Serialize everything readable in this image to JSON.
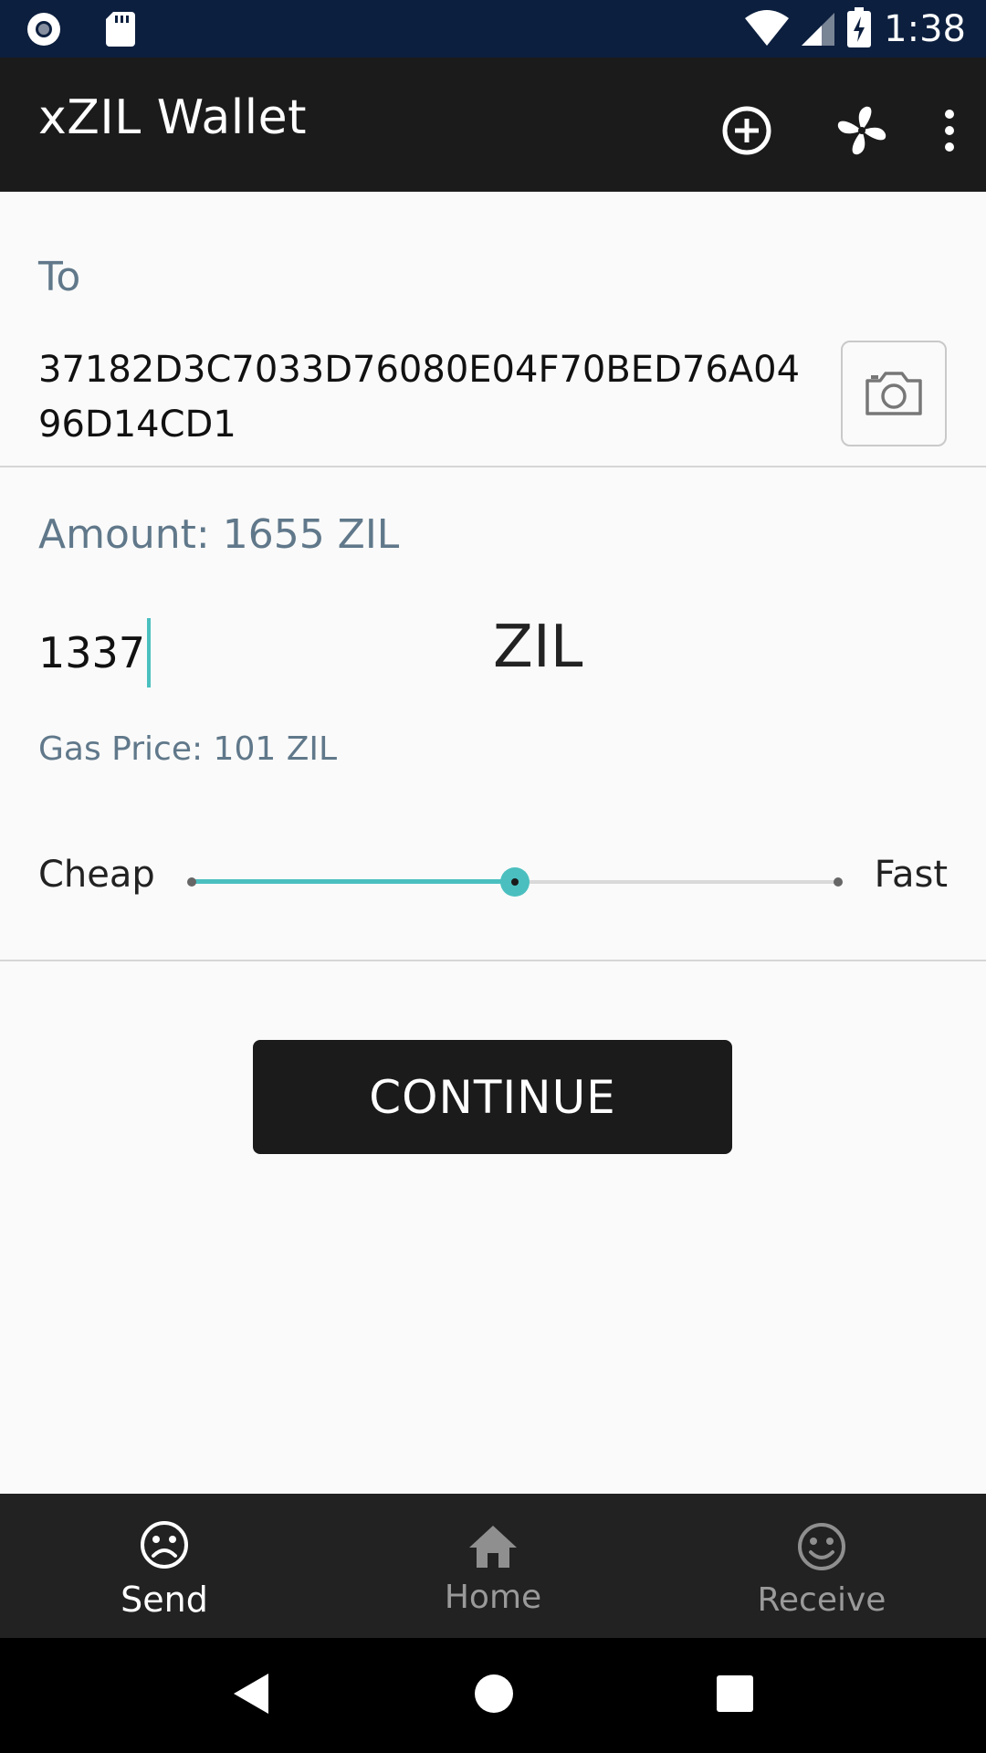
{
  "status_bar": {
    "time": "1:38"
  },
  "app_bar": {
    "title": "xZIL Wallet"
  },
  "form": {
    "to_label": "To",
    "to_address": "37182D3C7033D76080E04F70BED76A0496D14CD1",
    "amount_label": "Amount: 1655 ZIL",
    "amount_value": "1337",
    "unit": "ZIL",
    "gas_label": "Gas Price: 101 ZIL",
    "slider_min_label": "Cheap",
    "slider_max_label": "Fast",
    "slider_value": 0.5,
    "continue_label": "CONTINUE"
  },
  "bottom_nav": {
    "items": [
      {
        "label": "Send",
        "icon": "sad-face-icon",
        "active": true
      },
      {
        "label": "Home",
        "icon": "home-icon",
        "active": false
      },
      {
        "label": "Receive",
        "icon": "smile-face-icon",
        "active": false
      }
    ]
  },
  "colors": {
    "accent": "#4bbfbf",
    "status_bar": "#0c1f3f",
    "app_bar": "#1b1b1b",
    "label": "#60788a"
  }
}
